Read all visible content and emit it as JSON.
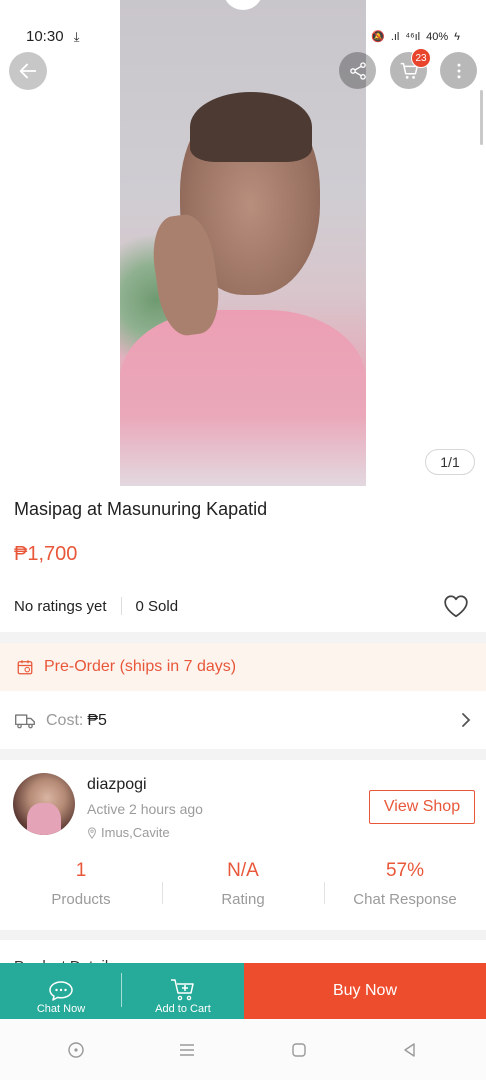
{
  "status_bar": {
    "time": "10:30",
    "signal_text": "⁴⁶ıl",
    "battery": "40%"
  },
  "header": {
    "cart_count": "23",
    "image_counter": "1/1"
  },
  "product": {
    "title": "Masipag at Masunuring Kapatid",
    "price": "₱1,700",
    "ratings": "No ratings yet",
    "sold": "0 Sold"
  },
  "preorder": {
    "label": "Pre-Order (ships in 7 days)"
  },
  "shipping": {
    "label": "Cost:",
    "value": "₱5"
  },
  "shop": {
    "name": "diazpogi",
    "active": "Active 2 hours ago",
    "location": "Imus,Cavite",
    "view_shop_label": "View Shop",
    "metrics": [
      {
        "value": "1",
        "label": "Products"
      },
      {
        "value": "N/A",
        "label": "Rating"
      },
      {
        "value": "57%",
        "label": "Chat Response"
      }
    ]
  },
  "next_section": {
    "partial_title": "Product Details"
  },
  "bottom_bar": {
    "chat_label": "Chat Now",
    "add_cart_label": "Add to Cart",
    "buy_label": "Buy Now"
  },
  "colors": {
    "accent": "#ee4d2d",
    "teal": "#26aa99"
  }
}
